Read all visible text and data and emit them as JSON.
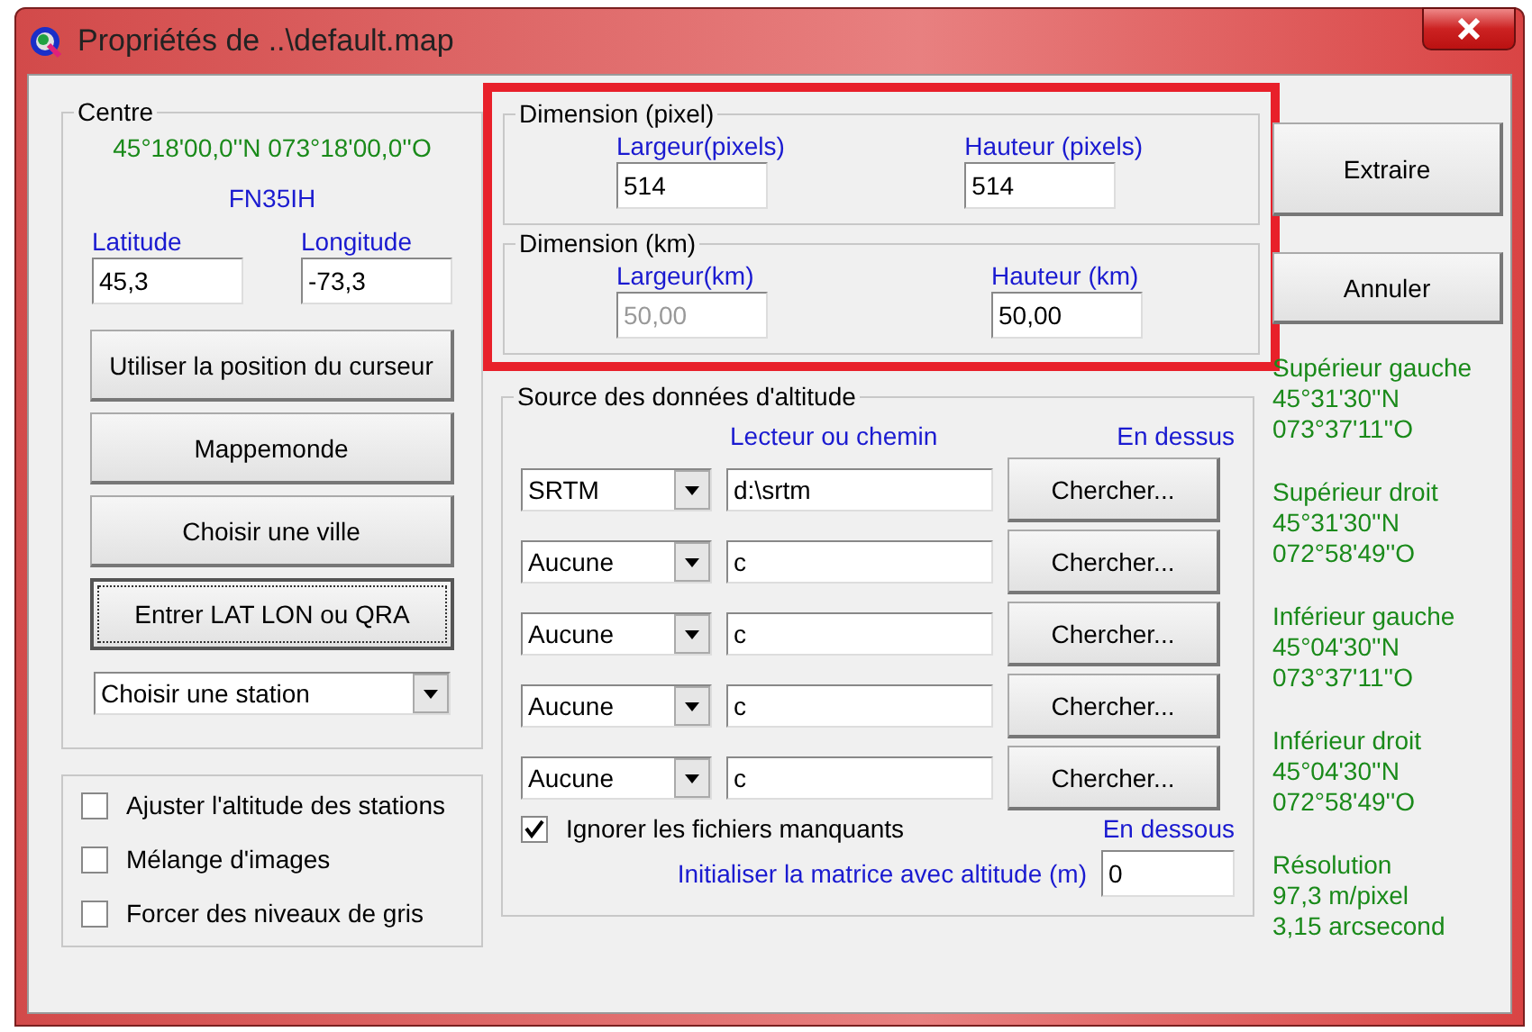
{
  "window": {
    "title": "Propriétés de ..\\default.map"
  },
  "centre": {
    "title": "Centre",
    "coordinates": "45°18'00,0''N 073°18'00,0''O",
    "locator": "FN35IH",
    "latitude": {
      "label": "Latitude",
      "value": "45,3"
    },
    "longitude": {
      "label": "Longitude",
      "value": "-73,3"
    },
    "buttons": [
      {
        "label": "Utiliser la position du curseur",
        "focused": false
      },
      {
        "label": "Mappemonde",
        "focused": false
      },
      {
        "label": "Choisir une ville",
        "focused": false
      },
      {
        "label": "Entrer LAT LON ou QRA",
        "focused": true
      }
    ],
    "station": {
      "value": "Choisir une station"
    }
  },
  "options": [
    {
      "label": "Ajuster l'altitude des stations",
      "checked": false
    },
    {
      "label": "Mélange d'images",
      "checked": false
    },
    {
      "label": "Forcer des niveaux de gris",
      "checked": false
    }
  ],
  "dimension_pixel": {
    "title": "Dimension (pixel)",
    "fields": [
      {
        "label": "Largeur(pixels)",
        "value": "514",
        "disabled": false
      },
      {
        "label": "Hauteur (pixels)",
        "value": "514",
        "disabled": false
      }
    ]
  },
  "dimension_km": {
    "title": "Dimension (km)",
    "fields": [
      {
        "label": "Largeur(km)",
        "value": "50,00",
        "disabled": true
      },
      {
        "label": "Hauteur (km)",
        "value": "50,00",
        "disabled": false
      }
    ]
  },
  "source": {
    "title": "Source des données d'altitude",
    "path_header": "Lecteur ou chemin",
    "above": "En dessus",
    "below": "En dessous",
    "rows": [
      {
        "type": "SRTM",
        "path": "d:\\srtm",
        "button": "Chercher..."
      },
      {
        "type": "Aucune",
        "path": "c",
        "button": "Chercher..."
      },
      {
        "type": "Aucune",
        "path": "c",
        "button": "Chercher..."
      },
      {
        "type": "Aucune",
        "path": "c",
        "button": "Chercher..."
      },
      {
        "type": "Aucune",
        "path": "c",
        "button": "Chercher..."
      }
    ],
    "ignore_missing": {
      "label": "Ignorer les fichiers manquants",
      "checked": true
    },
    "init_label": "Initialiser la matrice avec altitude (m)",
    "init_value": "0"
  },
  "actions": [
    "Extraire",
    "Annuler"
  ],
  "corners": [
    {
      "title": "Supérieur gauche",
      "lines": [
        "45°31'30''N",
        "073°37'11''O"
      ]
    },
    {
      "title": "Supérieur droit",
      "lines": [
        "45°31'30''N",
        "072°58'49''O"
      ]
    },
    {
      "title": "Inférieur gauche",
      "lines": [
        "45°04'30''N",
        "073°37'11''O"
      ]
    },
    {
      "title": "Inférieur droit",
      "lines": [
        "45°04'30''N",
        "072°58'49''O"
      ]
    },
    {
      "title": "Résolution",
      "lines": [
        "97,3 m/pixel",
        "3,15 arcsecond"
      ]
    }
  ]
}
